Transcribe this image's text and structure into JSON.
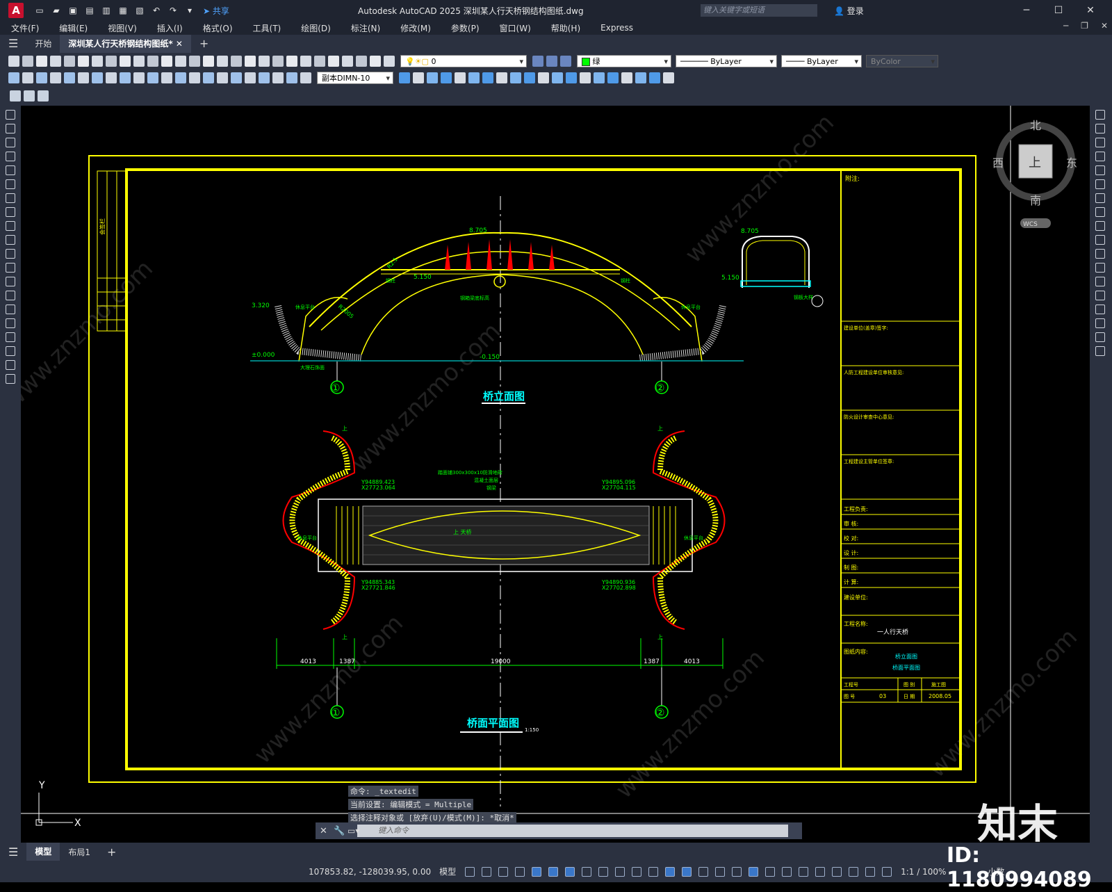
{
  "titlebar": {
    "app_letter": "A",
    "share_label": "共享",
    "title": "Autodesk AutoCAD 2025    深圳某人行天桥钢结构图纸.dwg",
    "search_placeholder": "键入关键字或短语",
    "login": "登录"
  },
  "menus": [
    "文件(F)",
    "编辑(E)",
    "视图(V)",
    "插入(I)",
    "格式(O)",
    "工具(T)",
    "绘图(D)",
    "标注(N)",
    "修改(M)",
    "参数(P)",
    "窗口(W)",
    "帮助(H)",
    "Express"
  ],
  "tabs": {
    "start": "开始",
    "doc": "深圳某人行天桥钢结构图纸*",
    "add": "+"
  },
  "props": {
    "layer": "0",
    "color": "绿",
    "color_hex": "#00ff00",
    "linetype": "ByLayer",
    "lineweight": "ByLayer",
    "plotstyle": "ByColor",
    "dimstyle": "副本DIMN-10"
  },
  "viewcube": {
    "north": "北",
    "south": "南",
    "east": "东",
    "west": "西",
    "face": "上",
    "wcs": "WCS"
  },
  "ucs": {
    "y": "Y",
    "x": "X"
  },
  "drawing": {
    "title_elev": "桥立面图",
    "title_plan": "桥面平面图",
    "plan_scale": "1:150",
    "axis1": "①",
    "axis2": "②",
    "elev_top": "8.705",
    "elev_deck": "5.150",
    "elev_left": "3.320",
    "elev_ground": "±0.000",
    "elev_base": "-0.150",
    "sec_top": "8.705",
    "sec_deck": "5.150",
    "dim_r1": "R2.1",
    "dim_r2": "R2005",
    "note_left": "休息平台",
    "note_right": "休息平台",
    "note_base": "大理石饰面",
    "note_center": "钢箱梁底标高",
    "note_sec": "钢板大样",
    "note_label_left": "钢柱",
    "note_label_right": "钢柱",
    "coord_tl1": "Y94889.423",
    "coord_tl2": "X27723.064",
    "coord_tr1": "Y94895.096",
    "coord_tr2": "X27704.115",
    "coord_bl1": "Y94885.343",
    "coord_bl2": "X27721.846",
    "coord_br1": "Y94890.936",
    "coord_br2": "X27702.898",
    "plan_note1": "踏面铺300x300x10防滑地砖",
    "plan_note2": "混凝土面层",
    "plan_note3": "钢梁",
    "plan_center": "上 天桥",
    "plan_up": "上",
    "plan_left_lbl": "休息平台",
    "plan_right_lbl": "休息平台",
    "dims": [
      "4013",
      "1387",
      "19000",
      "1387",
      "4013"
    ],
    "notes_title": "附注:",
    "tb_rows": [
      "工程负责:",
      "审 核:",
      "校 对:",
      "设 计:",
      "制 图:",
      "计 算:"
    ],
    "tb_sections": [
      "建设单位(盖章)签字:",
      "人防工程建设单位审核意见:",
      "防火设计审查中心意见:",
      "工程建设主管单位签章:"
    ],
    "tb_project_label": "建设单位:",
    "tb_name_label": "工程名称:",
    "tb_name": "一人行天桥",
    "tb_content_label": "图纸内容:",
    "tb_content1": "桥立面图",
    "tb_content2": "桥面平面图",
    "tb_grid": [
      "工程号",
      "图 别",
      "施工图",
      "图 号",
      "03",
      "日 期",
      "2008.05"
    ],
    "left_strip": [
      "会签栏",
      "专 业",
      "建 筑",
      "结 构",
      "给排水",
      "电 气",
      "暖 通"
    ]
  },
  "cmd": {
    "h1": "命令: _textedit",
    "h2": "当前设置: 编辑模式 = Multiple",
    "h3": "选择注释对象或 [放弃(U)/模式(M)]: *取消*",
    "placeholder": "键入命令"
  },
  "layout_tabs": {
    "model": "模型",
    "layout1": "布局1",
    "add": "+"
  },
  "status": {
    "coords": "107853.82, -128039.95, 0.00",
    "space": "模型",
    "scale": "1:1 / 100%",
    "units": "小数"
  },
  "watermark": {
    "brand": "知末",
    "id": "ID: 1180994089",
    "site": "www.znzmo.com"
  }
}
